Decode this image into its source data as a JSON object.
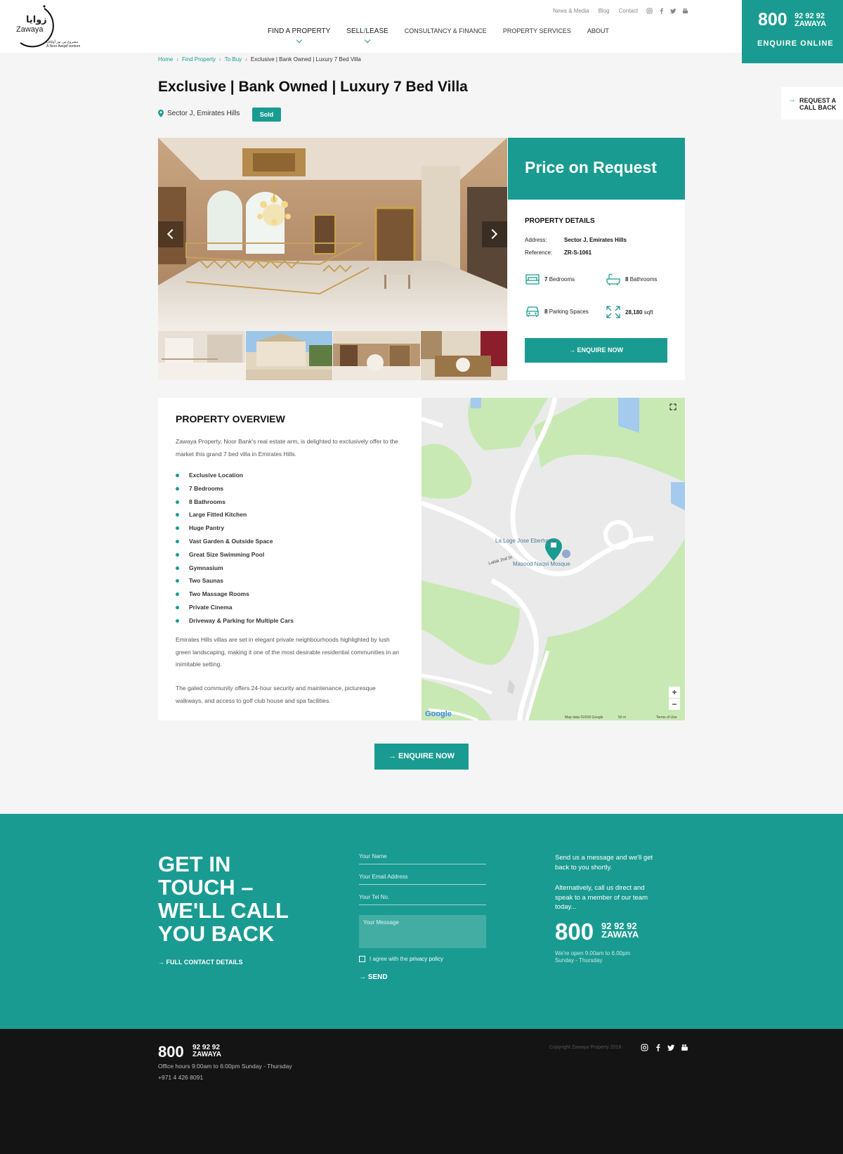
{
  "logo": {
    "arabic": "زوايا",
    "english": "Zawaya",
    "tagline_ar": "مشروع من نور أوقاف",
    "tagline_en": "A Noor Awqaf venture"
  },
  "header": {
    "utility_links": [
      "News & Media",
      "Blog",
      "Contact"
    ],
    "social_icons": [
      "instagram-icon",
      "facebook-icon",
      "twitter-icon",
      "youtube-icon"
    ],
    "nav": [
      {
        "label": "FIND A PROPERTY"
      },
      {
        "label_a": "SELL",
        "label_sep": "/",
        "label_b": "LEASE"
      },
      {
        "label": "CONSULTANCY & FINANCE"
      },
      {
        "label": "PROPERTY SERVICES"
      },
      {
        "label": "ABOUT"
      }
    ],
    "phone": {
      "prefix": "800",
      "digits": "92 92 92",
      "word": "ZAWAYA"
    },
    "enquire_online": "ENQUIRE ONLINE",
    "request_callback": [
      "REQUEST A",
      "CALL BACK"
    ]
  },
  "breadcrumb": [
    "Home",
    "Find Property",
    "To Buy",
    "Exclusive | Bank Owned | Luxury 7 Bed Villa"
  ],
  "breadcrumb_sep": "›",
  "listing": {
    "title": "Exclusive | Bank Owned | Luxury 7 Bed Villa",
    "location": "Sector J, Emirates Hills",
    "status": "Sold"
  },
  "price": {
    "label": "Price on Request",
    "details_title": "PROPERTY DETAILS",
    "address_label": "Address:",
    "address": "Sector J, Emirates Hills",
    "reference_label": "Reference:",
    "reference": "ZR-S-1061",
    "bedrooms": {
      "count": "7",
      "label": "Bedrooms"
    },
    "bathrooms": {
      "count": "8",
      "label": "Bathrooms"
    },
    "parking": {
      "count": "8",
      "label": "Parking Spaces"
    },
    "area": {
      "count": "28,180",
      "label": "sqft"
    },
    "enquire": "ENQUIRE NOW"
  },
  "overview": {
    "title": "PROPERTY OVERVIEW",
    "intro": "Zawaya Property, Noor Bank's real estate arm, is delighted to exclusively offer to the market this grand 7 bed villa in Emirates Hills.",
    "features": [
      "Exclusive Location",
      "7 Bedrooms",
      "8 Bathrooms",
      "Large Fitted Kitchen",
      "Huge Pantry",
      "Vast Garden & Outside Space",
      "Great Size Swimming Pool",
      "Gymnasium",
      "Two Saunas",
      "Two Massage Rooms",
      "Private Cinema",
      "Driveway & Parking for Multiple Cars"
    ],
    "para2": "Emirates Hills villas are set in elegant private neighbourhoods highlighted by lush green landscaping, making it one of the most desirable residential communities in an inimitable setting.",
    "para3": "The gated community offers 24-hour security and maintenance, picturesque walkways, and access to golf club house and spa facilities."
  },
  "map": {
    "place1": "La Loge Jose Eberhardt",
    "place2": "Masood Naqvi Mosque",
    "street": "Lailak 2nd St",
    "google": "Google",
    "attribution": "Map data ©2018 Google",
    "scale": "50 m",
    "terms": "Terms of Use",
    "zoom_in": "+",
    "zoom_out": "−"
  },
  "cta_enquire": "ENQUIRE NOW",
  "contact": {
    "heading": "GET IN TOUCH – WE'LL CALL YOU BACK",
    "full_details": "FULL CONTACT DETAILS",
    "name_placeholder": "Your Name",
    "email_placeholder": "Your Email Address",
    "tel_placeholder": "Your Tel No.",
    "message_placeholder": "Your Message",
    "agree_text": "I agree with the",
    "privacy": "privacy policy",
    "send": "SEND",
    "para1": "Send us a message and we'll get back to you shortly.",
    "para2": "Alternatively, call us direct and speak to a member of our team today...",
    "phone_prefix": "800",
    "phone_digits": "92 92 92",
    "phone_word": "ZAWAYA",
    "hours1": "We're open 9.00am to 6.00pm",
    "hours2": "Sunday - Thursday"
  },
  "footer": {
    "phone_prefix": "800",
    "phone_digits": "92 92 92",
    "phone_word": "ZAWAYA",
    "hours": "Office hours 9:00am to 6:00pm Sunday - Thursday",
    "tel": "+971 4 426 8091",
    "copyright": "Copyright Zawaya Property 2018"
  },
  "colors": {
    "brand": "#1a9b91",
    "footer_bg": "#141414",
    "page_bg": "#f5f5f5"
  }
}
